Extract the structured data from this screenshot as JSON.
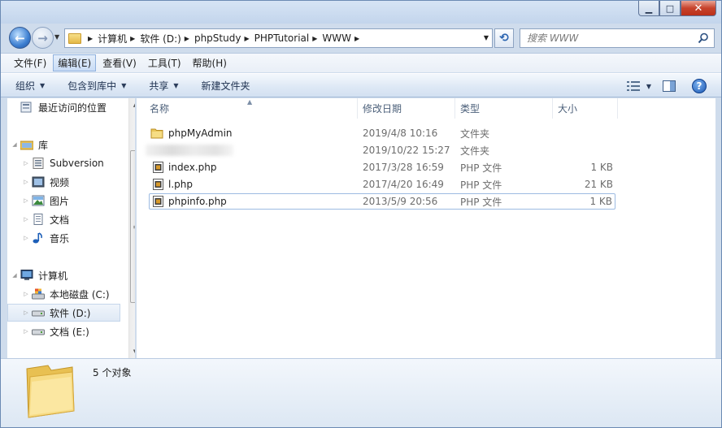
{
  "window": {
    "caption_minimize": "▁",
    "caption_maximize": "□",
    "caption_close": "✕"
  },
  "navigation": {
    "breadcrumbs": [
      "计算机",
      "软件 (D:)",
      "phpStudy",
      "PHPTutorial",
      "WWW"
    ],
    "search_placeholder": "搜索 WWW"
  },
  "menubar": {
    "items": [
      "文件(F)",
      "编辑(E)",
      "查看(V)",
      "工具(T)",
      "帮助(H)"
    ],
    "active_index": 1
  },
  "commandbar": {
    "organize": "组织",
    "include_in_library": "包含到库中",
    "share": "共享",
    "new_folder": "新建文件夹"
  },
  "sidebar": {
    "items": [
      {
        "label": "最近访问的位置",
        "icon": "recent-places-icon"
      },
      {
        "label": "库",
        "icon": "library-icon"
      },
      {
        "label": "Subversion",
        "icon": "subversion-icon"
      },
      {
        "label": "视频",
        "icon": "video-icon"
      },
      {
        "label": "图片",
        "icon": "pictures-icon"
      },
      {
        "label": "文档",
        "icon": "documents-icon"
      },
      {
        "label": "音乐",
        "icon": "music-icon"
      },
      {
        "label": "计算机",
        "icon": "computer-icon"
      },
      {
        "label": "本地磁盘 (C:)",
        "icon": "system-drive-icon"
      },
      {
        "label": "软件 (D:)",
        "icon": "drive-icon",
        "selected": true
      },
      {
        "label": "文档 (E:)",
        "icon": "drive-icon"
      }
    ]
  },
  "file_list": {
    "columns": [
      "名称",
      "修改日期",
      "类型",
      "大小"
    ],
    "rows": [
      {
        "name": "phpMyAdmin",
        "date": "2019/4/8 10:16",
        "type": "文件夹",
        "size": "",
        "icon": "folder-icon"
      },
      {
        "name": "",
        "date": "2019/10/22 15:27",
        "type": "文件夹",
        "size": "",
        "icon": "redacted-name"
      },
      {
        "name": "index.php",
        "date": "2017/3/28 16:59",
        "type": "PHP 文件",
        "size": "1 KB",
        "icon": "php-file-icon"
      },
      {
        "name": "l.php",
        "date": "2017/4/20 16:49",
        "type": "PHP 文件",
        "size": "21 KB",
        "icon": "php-file-icon"
      },
      {
        "name": "phpinfo.php",
        "date": "2013/5/9 20:56",
        "type": "PHP 文件",
        "size": "1 KB",
        "icon": "php-file-icon"
      }
    ]
  },
  "details": {
    "status": "5 个对象"
  },
  "colors": {
    "accent": "#2b5aa5",
    "chrome": "#cfdcec",
    "selection": "#dfe9f5"
  }
}
